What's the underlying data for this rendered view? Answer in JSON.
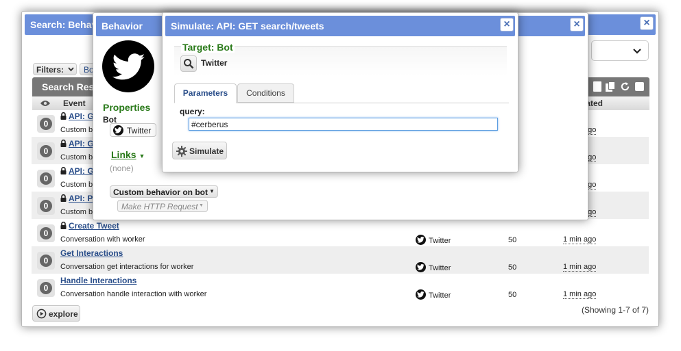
{
  "search_window": {
    "title": "Search: Behaviors",
    "close_label": "×",
    "filters_label": "Filters:",
    "filter_chip": "Bo",
    "results_header": "Search Results",
    "columns": {
      "event": "Event",
      "updated": "Updated"
    },
    "rows": [
      {
        "count": "0",
        "title": "API: GET search/tweets",
        "desc": "Custom behavior on bot",
        "bot": "",
        "count2": "",
        "updated": "1 min ago",
        "locked": true
      },
      {
        "count": "0",
        "title": "API: GET statuses",
        "desc": "Custom behavior on bot",
        "bot": "",
        "count2": "",
        "updated": "1 min ago",
        "locked": true
      },
      {
        "count": "0",
        "title": "API: GET users",
        "desc": "Custom behavior on bot",
        "bot": "",
        "count2": "",
        "updated": "1 min ago",
        "locked": true
      },
      {
        "count": "0",
        "title": "API: POST statuses",
        "desc": "Custom behavior on bot",
        "bot": "",
        "count2": "",
        "updated": "1 min ago",
        "locked": true
      },
      {
        "count": "0",
        "title": "Create Tweet",
        "desc": "Conversation with worker",
        "bot": "Twitter",
        "count2": "50",
        "updated": "1 min ago",
        "locked": true
      },
      {
        "count": "0",
        "title": "Get Interactions",
        "desc": "Conversation get interactions for worker",
        "bot": "Twitter",
        "count2": "50",
        "updated": "1 min ago",
        "locked": false
      },
      {
        "count": "0",
        "title": "Handle Interactions",
        "desc": "Conversation handle interaction with worker",
        "bot": "Twitter",
        "count2": "50",
        "updated": "1 min ago",
        "locked": false
      }
    ],
    "explore_label": "explore",
    "showing": "(Showing 1-7 of 7)"
  },
  "behavior_window": {
    "title": "Behavior",
    "close_label": "×",
    "properties_label": "Properties",
    "bot_label": "Bot",
    "bot_value": "Twitter",
    "links_label": "Links",
    "links_value": "(none)",
    "custom_behavior_label": "Custom behavior on bot",
    "action_label": "Make HTTP Request"
  },
  "simulate_window": {
    "title": "Simulate: API: GET search/tweets",
    "close_label": "×",
    "target_label": "Target: Bot",
    "target_value": "Twitter",
    "tabs": [
      "Parameters",
      "Conditions"
    ],
    "query_label": "query:",
    "query_value": "#cerberus",
    "simulate_label": "Simulate"
  }
}
